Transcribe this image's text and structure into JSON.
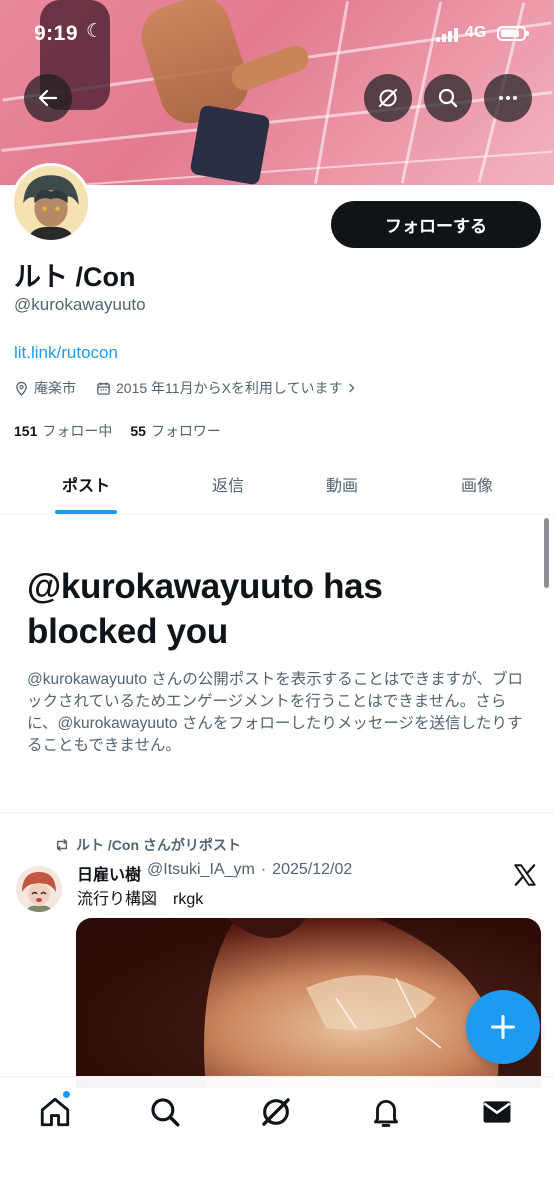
{
  "status_bar": {
    "time": "9:19",
    "network": "4G"
  },
  "header": {
    "back_icon": "arrow-left-icon",
    "grok_icon": "grok-icon",
    "search_icon": "search-icon",
    "more_icon": "more-icon"
  },
  "profile": {
    "display_name": "ルト /Con",
    "handle": "@kurokawayuuto",
    "follow_label": "フォローする",
    "link": "lit.link/rutocon",
    "location": "庵楽市",
    "joined": "2015 年11月からXを利用しています",
    "following_count": "151",
    "following_label": "フォロー中",
    "followers_count": "55",
    "followers_label": "フォロワー"
  },
  "tabs": [
    {
      "label": "ポスト",
      "active": true
    },
    {
      "label": "返信",
      "active": false
    },
    {
      "label": "動画",
      "active": false
    },
    {
      "label": "画像",
      "active": false
    }
  ],
  "blocked": {
    "title": "@kurokawayuuto has blocked you",
    "body": "@kurokawayuuto さんの公開ポストを表示することはできますが、ブロックされているためエンゲージメントを行うことはできません。さらに、@kurokawayuuto さんをフォローしたりメッセージを送信したりすることもできません。"
  },
  "post": {
    "repost_label": "ルト /Con さんがリポスト",
    "author_name": "日雇い樹",
    "author_handle": "@Itsuki_IA_ym",
    "date": "2025/12/02",
    "text": "流行り構図　rkgk"
  },
  "bottom_nav": [
    "home-icon",
    "search-icon",
    "grok-icon",
    "notifications-icon",
    "messages-icon"
  ],
  "colors": {
    "accent": "#1d9bf0",
    "text": "#0f1419",
    "secondary": "#536471"
  }
}
